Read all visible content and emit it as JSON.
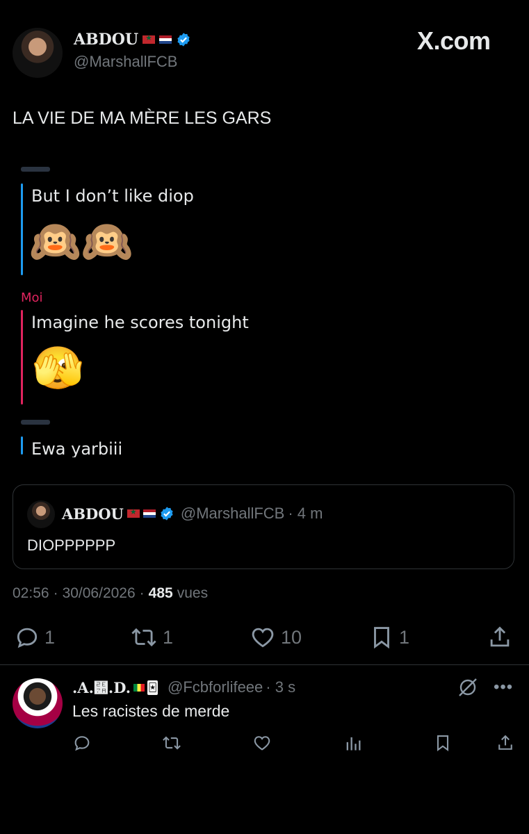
{
  "tweet": {
    "author_name": "ABDOU",
    "author_handle": "@MarshallFCB",
    "watermark": "X.com",
    "text": "LA VIE DE MA MÈRE LES GARS",
    "screenshot": {
      "msg1_text": "But I don’t like diop",
      "msg1_emoji": "🙉🙉",
      "sender_label": "Moi",
      "msg2_text": "Imagine he scores tonight",
      "msg2_emoji": "🫣",
      "msg3_text": "Ewa yarbiii"
    },
    "quote": {
      "author_name": "ABDOU",
      "author_handle": "@MarshallFCB",
      "time": "· 4 m",
      "text": "DIOPPPPPP"
    },
    "meta": {
      "time": "02:56",
      "sep1": "·",
      "date": "30/06/2026",
      "sep2": "·",
      "views_count": "485",
      "views_label": "vues"
    },
    "actions": {
      "replies": "1",
      "reposts": "1",
      "likes": "10",
      "bookmarks": "1"
    }
  },
  "reply": {
    "author_name": ".A.⹺.D.",
    "author_handle": "@Fcbforlifeee",
    "time": "· 3 s",
    "text": "Les racistes de merde"
  },
  "colors": {
    "background": "#000000",
    "text": "#e7e9ea",
    "muted": "#71767b",
    "verified": "#1d9bf0",
    "blue_line": "#1d9bf0",
    "red_line": "#e0245e"
  }
}
